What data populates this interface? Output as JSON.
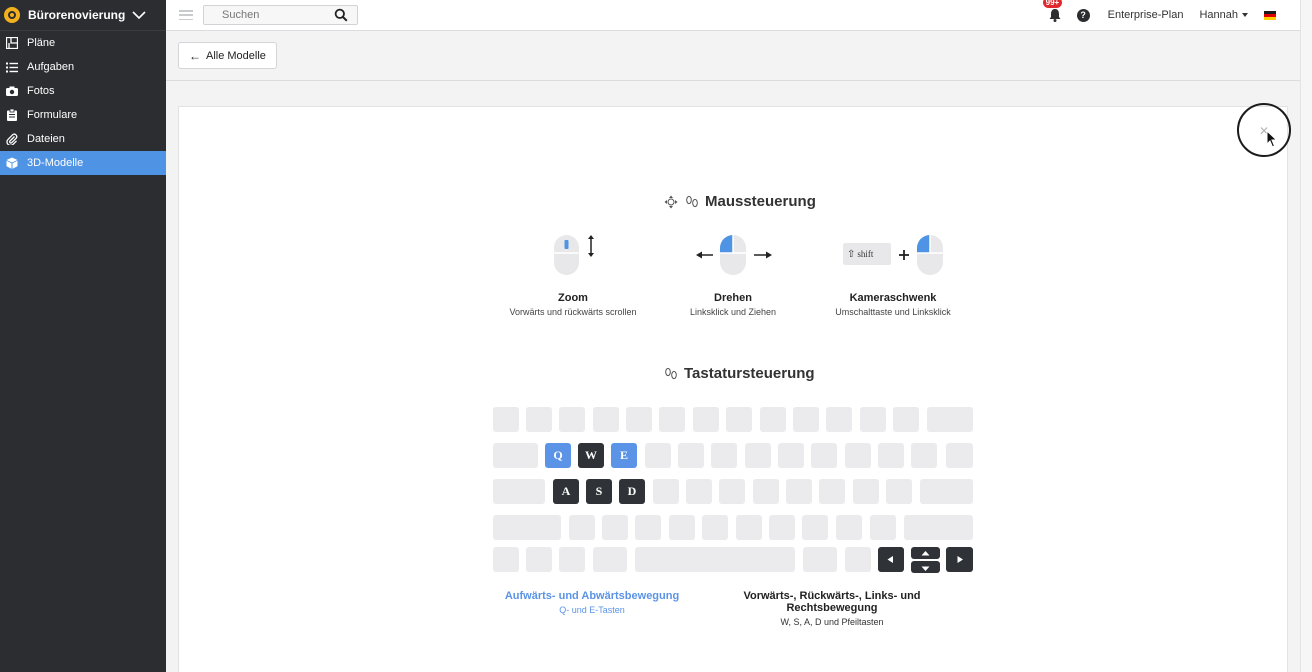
{
  "sidebar": {
    "project_name": "Bürorenovierung",
    "items": [
      {
        "label": "Pläne",
        "icon": "floorplan-icon"
      },
      {
        "label": "Aufgaben",
        "icon": "list-icon"
      },
      {
        "label": "Fotos",
        "icon": "camera-icon"
      },
      {
        "label": "Formulare",
        "icon": "clipboard-icon"
      },
      {
        "label": "Dateien",
        "icon": "paperclip-icon"
      },
      {
        "label": "3D-Modelle",
        "icon": "cube-icon",
        "active": true
      }
    ]
  },
  "topbar": {
    "search_placeholder": "Suchen",
    "notification_badge": "99+",
    "help_label": "?",
    "plan_label": "Enterprise-Plan",
    "user_name": "Hannah",
    "language_flag": "de-flag-icon"
  },
  "back_button": {
    "label": "Alle Modelle"
  },
  "help_overlay": {
    "close_icon": "close-icon",
    "mouse_section": {
      "title": "Maussteuerung",
      "controls": [
        {
          "title": "Zoom",
          "description": "Vorwärts und rückwärts scrollen"
        },
        {
          "title": "Drehen",
          "description": "Linksklick und Ziehen"
        },
        {
          "title": "Kameraschwenk",
          "description": "Umschalttaste und Linksklick",
          "key_label": "shift"
        }
      ]
    },
    "keyboard_section": {
      "title": "Tastatursteuerung",
      "keys": {
        "q": "Q",
        "w": "W",
        "e": "E",
        "a": "A",
        "s": "S",
        "d": "D"
      },
      "captions": [
        {
          "title": "Aufwärts- und Abwärtsbewegung",
          "description": "Q- und E-Tasten",
          "color": "#5b93e6"
        },
        {
          "title": "Vorwärts-, Rückwärts-, Links- und Rechtsbewegung",
          "description": "W, S, A, D und Pfeiltasten",
          "color": "#222222"
        }
      ]
    }
  },
  "colors": {
    "accent": "#4f93e4",
    "key_highlight_blue": "#5b93e6",
    "key_dark": "#2f3237",
    "sidebar_bg": "#2b2d31"
  }
}
